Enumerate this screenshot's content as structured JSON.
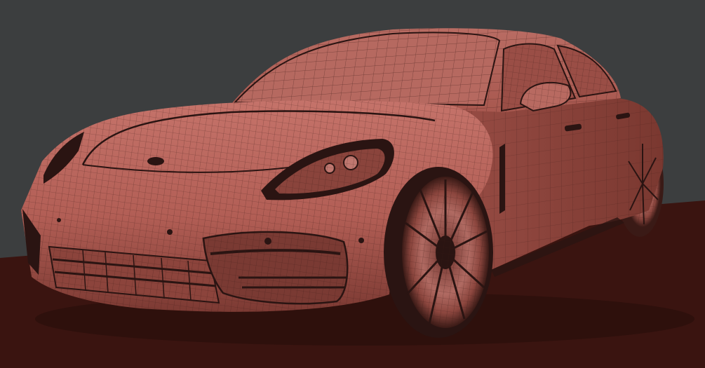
{
  "viewport": {
    "subject": "car-wireframe-render",
    "colors": {
      "background": "#3c3e3f",
      "ground": "#3a1410",
      "body": "#b8635a",
      "body_shadow": "#7a3a33",
      "wire": "#3b1a16",
      "glass": "#a85a52",
      "dark_trim": "#2a1412"
    }
  }
}
